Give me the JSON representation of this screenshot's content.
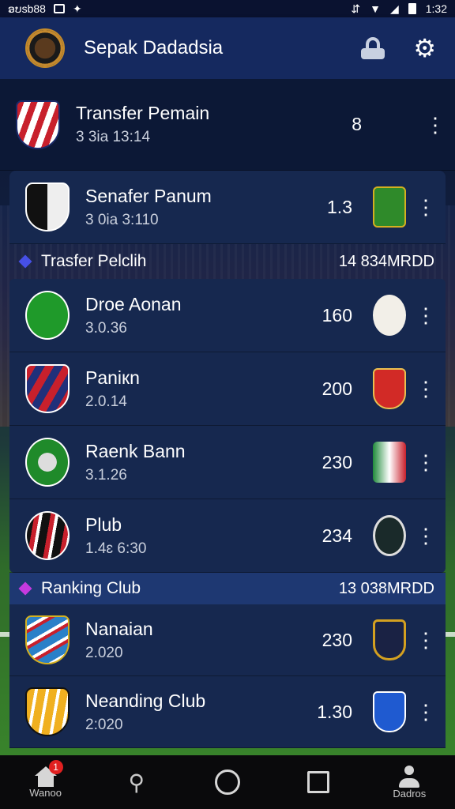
{
  "status_bar": {
    "left_text": "ອບsb88",
    "time": "1:32"
  },
  "app_bar": {
    "title": "Sepak Dadadsia"
  },
  "top_item": {
    "name": "Transfer Pemain",
    "sub": "3 3ia 13:14",
    "value": "8"
  },
  "second_item": {
    "name": "Senafer Panum",
    "sub": "3 0ia 3:110",
    "value": "1.3"
  },
  "section_1": {
    "label": "Trasfer Pelclih",
    "right": "14 834MRDD",
    "accent": "#4650e6"
  },
  "list_1": [
    {
      "name": "Droe Aonan",
      "sub": "3.0.36",
      "value": "160",
      "crest_icon": "green-club-crest-icon",
      "badge_icon": "kar-badge-icon"
    },
    {
      "name": "Paniкn",
      "sub": "2.0.14",
      "value": "200",
      "crest_icon": "red-striped-crest-icon",
      "badge_icon": "red-shield-badge-icon"
    },
    {
      "name": "Raenk Bann",
      "sub": "3.1.26",
      "value": "230",
      "crest_icon": "green-round-crest-icon",
      "badge_icon": "green-tower-badge-icon"
    },
    {
      "name": "Plub",
      "sub": "1.4ɛ 6:30",
      "value": "234",
      "crest_icon": "black-red-crest-icon",
      "badge_icon": "dark-round-badge-icon"
    }
  ],
  "section_2": {
    "label": "Ranking Club",
    "right": "13 038MRDD",
    "accent": "#c53adf"
  },
  "list_2": [
    {
      "name": "Nanaian",
      "sub": "2.020",
      "value": "230",
      "crest_icon": "blue-striped-crest-icon",
      "badge_icon": "gold-shield-badge-icon"
    },
    {
      "name": "Neanding Club",
      "sub": "2:020",
      "value": "1.30",
      "crest_icon": "yellow-striped-crest-icon",
      "badge_icon": "blue-shield-badge-icon"
    }
  ],
  "nav": {
    "home_label": "Wanoo",
    "notif_count": "1",
    "profile_label": "Dadros"
  }
}
